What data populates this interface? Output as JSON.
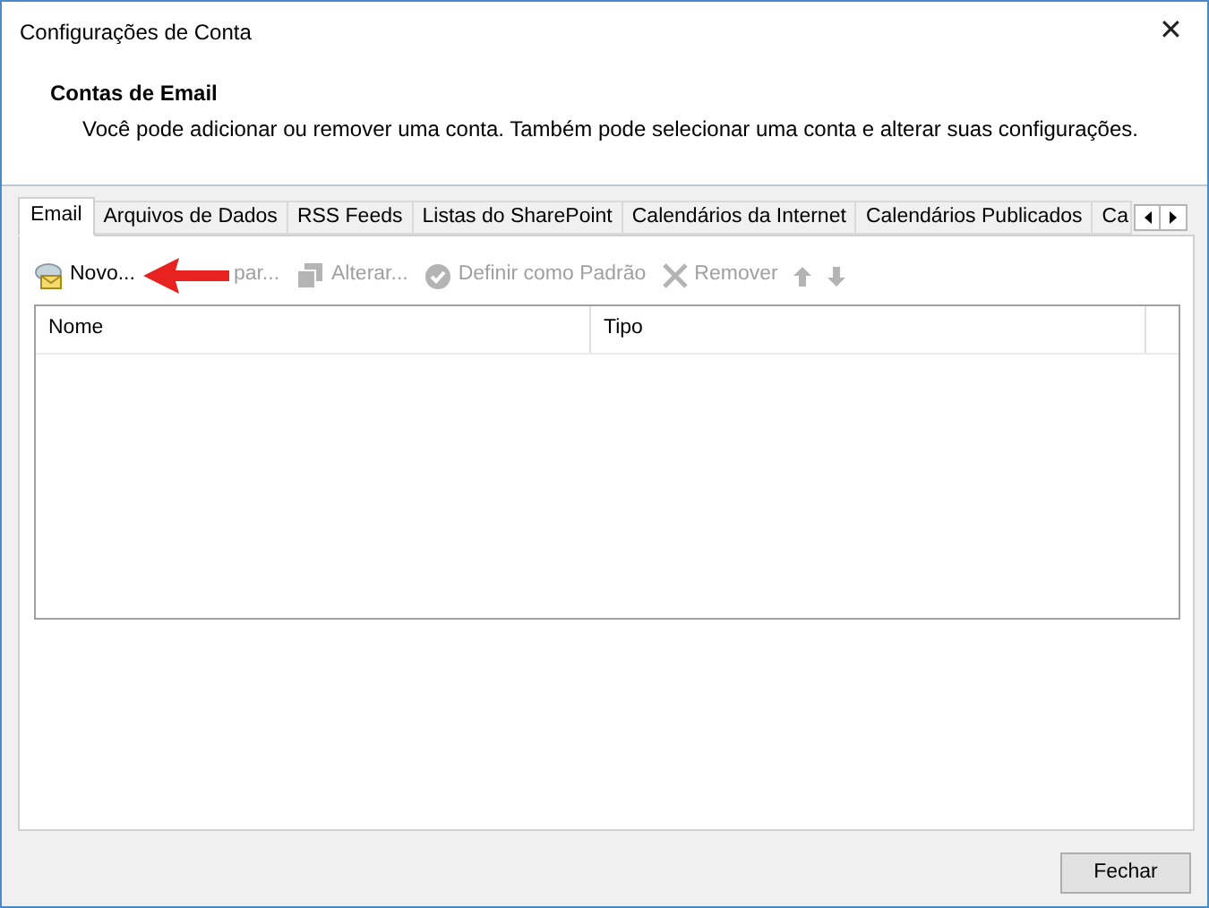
{
  "window": {
    "title": "Configurações de Conta",
    "close": "✕"
  },
  "header": {
    "title": "Contas de Email",
    "description": "Você pode adicionar ou remover uma conta. Também pode selecionar uma conta e alterar suas configurações."
  },
  "tabs": [
    {
      "label": "Email",
      "selected": true
    },
    {
      "label": "Arquivos de Dados",
      "selected": false
    },
    {
      "label": "RSS Feeds",
      "selected": false
    },
    {
      "label": "Listas do SharePoint",
      "selected": false
    },
    {
      "label": "Calendários da Internet",
      "selected": false
    },
    {
      "label": "Calendários Publicados",
      "selected": false
    },
    {
      "label": "Ca",
      "selected": false
    }
  ],
  "toolbar": [
    {
      "kind": "new",
      "label": "Novo...",
      "disabled": false
    },
    {
      "kind": "repair",
      "label": "par...",
      "disabled": true
    },
    {
      "kind": "change",
      "label": "Alterar...",
      "disabled": true
    },
    {
      "kind": "default",
      "label": "Definir como Padrão",
      "disabled": true
    },
    {
      "kind": "remove",
      "label": "Remover",
      "disabled": true
    },
    {
      "kind": "up",
      "disabled": true
    },
    {
      "kind": "down",
      "disabled": true
    }
  ],
  "table": {
    "columns": [
      "Nome",
      "Tipo"
    ]
  },
  "buttons": [
    "Fechar"
  ]
}
